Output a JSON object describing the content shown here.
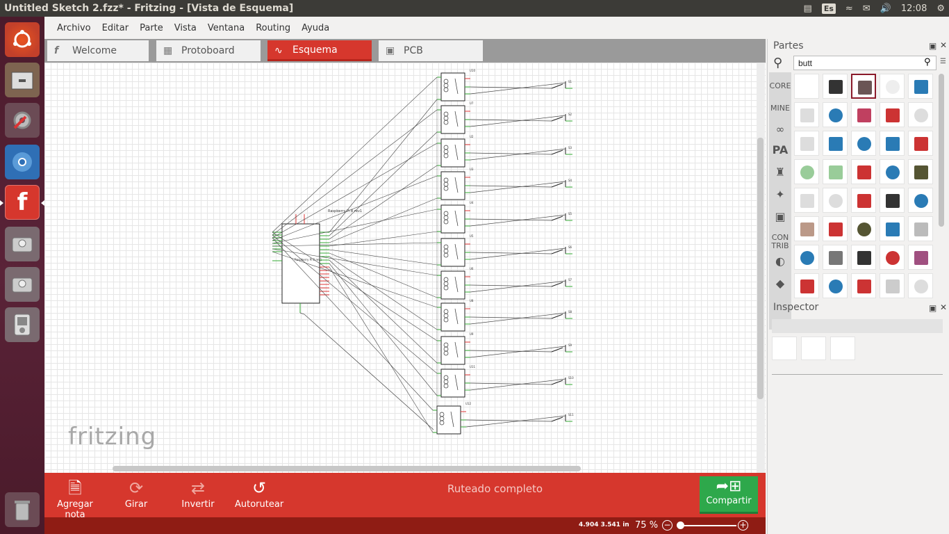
{
  "window": {
    "title": "Untitled Sketch 2.fzz* - Fritzing - [Vista de Esquema]"
  },
  "system_tray": {
    "keyboard": "Es",
    "clock": "12:08"
  },
  "menu": [
    "Archivo",
    "Editar",
    "Parte",
    "Vista",
    "Ventana",
    "Routing",
    "Ayuda"
  ],
  "tabs": [
    {
      "label": "Welcome",
      "icon": "fritzing-f-icon"
    },
    {
      "label": "Protoboard",
      "icon": "breadboard-icon"
    },
    {
      "label": "Esquema",
      "icon": "resistor-icon"
    },
    {
      "label": "PCB",
      "icon": "pcb-icon"
    }
  ],
  "active_tab": "Esquema",
  "canvas": {
    "logo": "fritzing",
    "schematic": {
      "rpi_label": "Raspberry Pi B rev1",
      "rpi_body_label": "Raspberry Pi B rev1",
      "relays": [
        "U10",
        "U7",
        "U2",
        "U3",
        "U4",
        "U5",
        "U6",
        "U8",
        "U9",
        "U11",
        "U12"
      ],
      "switches": [
        "S1",
        "S2",
        "S3",
        "S4",
        "S5",
        "S6",
        "S7",
        "S8",
        "S9",
        "S10",
        "S11"
      ]
    }
  },
  "toolbar": {
    "add_note": "Agregar nota",
    "rotate": "Girar",
    "flip": "Invertir",
    "autoroute": "Autorutear",
    "status": "Ruteado completo",
    "share": "Compartir"
  },
  "statusbar": {
    "coords": "4.904 3.541 in",
    "zoom": "75",
    "zoom_unit": "%"
  },
  "parts_panel": {
    "title": "Partes",
    "search_value": "butt",
    "bins": [
      "CORE",
      "MINE",
      "CON TRIB"
    ]
  },
  "inspector_panel": {
    "title": "Inspector"
  },
  "colors": {
    "accent": "#d6372d",
    "share": "#2ea84b",
    "launcher": "#4b1b2c"
  }
}
